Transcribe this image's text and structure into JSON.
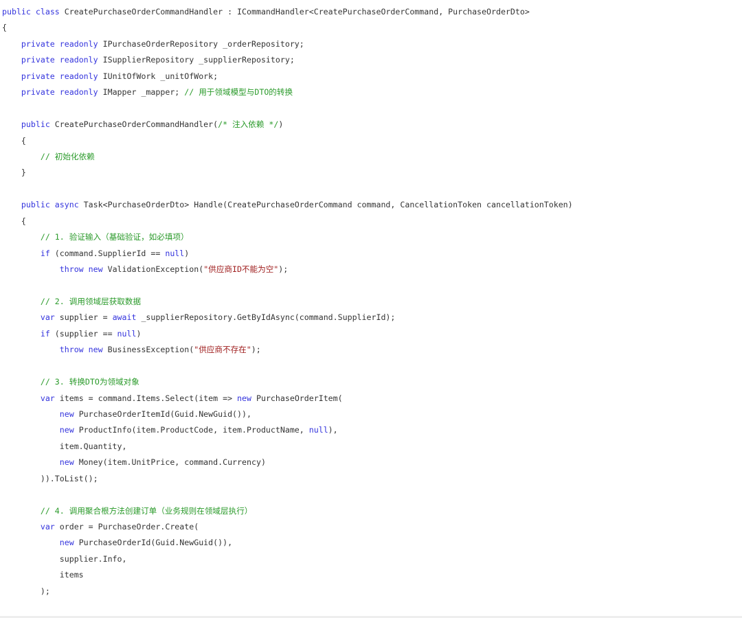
{
  "code": {
    "language": "csharp",
    "lines": [
      {
        "indent": 0,
        "tokens": [
          {
            "t": "kw",
            "v": "public"
          },
          {
            "t": "tx",
            "v": " "
          },
          {
            "t": "kw",
            "v": "class"
          },
          {
            "t": "tx",
            "v": " CreatePurchaseOrderCommandHandler : ICommandHandler<CreatePurchaseOrderCommand, PurchaseOrderDto>"
          }
        ]
      },
      {
        "indent": 0,
        "tokens": [
          {
            "t": "tx",
            "v": "{"
          }
        ]
      },
      {
        "indent": 1,
        "tokens": [
          {
            "t": "kw",
            "v": "private"
          },
          {
            "t": "tx",
            "v": " "
          },
          {
            "t": "kw",
            "v": "readonly"
          },
          {
            "t": "tx",
            "v": " IPurchaseOrderRepository _orderRepository;"
          }
        ]
      },
      {
        "indent": 1,
        "tokens": [
          {
            "t": "kw",
            "v": "private"
          },
          {
            "t": "tx",
            "v": " "
          },
          {
            "t": "kw",
            "v": "readonly"
          },
          {
            "t": "tx",
            "v": " ISupplierRepository _supplierRepository;"
          }
        ]
      },
      {
        "indent": 1,
        "tokens": [
          {
            "t": "kw",
            "v": "private"
          },
          {
            "t": "tx",
            "v": " "
          },
          {
            "t": "kw",
            "v": "readonly"
          },
          {
            "t": "tx",
            "v": " IUnitOfWork _unitOfWork;"
          }
        ]
      },
      {
        "indent": 1,
        "tokens": [
          {
            "t": "kw",
            "v": "private"
          },
          {
            "t": "tx",
            "v": " "
          },
          {
            "t": "kw",
            "v": "readonly"
          },
          {
            "t": "tx",
            "v": " IMapper _mapper; "
          },
          {
            "t": "cm",
            "v": "// 用于领域模型与DTO的转换"
          }
        ]
      },
      {
        "indent": 0,
        "tokens": []
      },
      {
        "indent": 1,
        "tokens": [
          {
            "t": "kw",
            "v": "public"
          },
          {
            "t": "tx",
            "v": " CreatePurchaseOrderCommandHandler("
          },
          {
            "t": "cm",
            "v": "/* 注入依赖 */"
          },
          {
            "t": "tx",
            "v": ")"
          }
        ]
      },
      {
        "indent": 1,
        "tokens": [
          {
            "t": "tx",
            "v": "{"
          }
        ]
      },
      {
        "indent": 2,
        "tokens": [
          {
            "t": "cm",
            "v": "// 初始化依赖"
          }
        ]
      },
      {
        "indent": 1,
        "tokens": [
          {
            "t": "tx",
            "v": "}"
          }
        ]
      },
      {
        "indent": 0,
        "tokens": []
      },
      {
        "indent": 1,
        "tokens": [
          {
            "t": "kw",
            "v": "public"
          },
          {
            "t": "tx",
            "v": " "
          },
          {
            "t": "kw",
            "v": "async"
          },
          {
            "t": "tx",
            "v": " Task<PurchaseOrderDto> Handle(CreatePurchaseOrderCommand command, CancellationToken cancellationToken)"
          }
        ]
      },
      {
        "indent": 1,
        "tokens": [
          {
            "t": "tx",
            "v": "{"
          }
        ]
      },
      {
        "indent": 2,
        "tokens": [
          {
            "t": "cm",
            "v": "// 1. 验证输入（基础验证，如必填项）"
          }
        ]
      },
      {
        "indent": 2,
        "tokens": [
          {
            "t": "kw",
            "v": "if"
          },
          {
            "t": "tx",
            "v": " (command.SupplierId == "
          },
          {
            "t": "kw",
            "v": "null"
          },
          {
            "t": "tx",
            "v": ")"
          }
        ]
      },
      {
        "indent": 3,
        "tokens": [
          {
            "t": "kw",
            "v": "throw"
          },
          {
            "t": "tx",
            "v": " "
          },
          {
            "t": "kw",
            "v": "new"
          },
          {
            "t": "tx",
            "v": " ValidationException("
          },
          {
            "t": "str",
            "v": "\"供应商ID不能为空\""
          },
          {
            "t": "tx",
            "v": ");"
          }
        ]
      },
      {
        "indent": 0,
        "tokens": []
      },
      {
        "indent": 2,
        "tokens": [
          {
            "t": "cm",
            "v": "// 2. 调用领域层获取数据"
          }
        ]
      },
      {
        "indent": 2,
        "tokens": [
          {
            "t": "kw",
            "v": "var"
          },
          {
            "t": "tx",
            "v": " supplier = "
          },
          {
            "t": "kw",
            "v": "await"
          },
          {
            "t": "tx",
            "v": " _supplierRepository.GetByIdAsync(command.SupplierId);"
          }
        ]
      },
      {
        "indent": 2,
        "tokens": [
          {
            "t": "kw",
            "v": "if"
          },
          {
            "t": "tx",
            "v": " (supplier == "
          },
          {
            "t": "kw",
            "v": "null"
          },
          {
            "t": "tx",
            "v": ")"
          }
        ]
      },
      {
        "indent": 3,
        "tokens": [
          {
            "t": "kw",
            "v": "throw"
          },
          {
            "t": "tx",
            "v": " "
          },
          {
            "t": "kw",
            "v": "new"
          },
          {
            "t": "tx",
            "v": " BusinessException("
          },
          {
            "t": "str",
            "v": "\"供应商不存在\""
          },
          {
            "t": "tx",
            "v": ");"
          }
        ]
      },
      {
        "indent": 0,
        "tokens": []
      },
      {
        "indent": 2,
        "tokens": [
          {
            "t": "cm",
            "v": "// 3. 转换DTO为领域对象"
          }
        ]
      },
      {
        "indent": 2,
        "tokens": [
          {
            "t": "kw",
            "v": "var"
          },
          {
            "t": "tx",
            "v": " items = command.Items.Select(item => "
          },
          {
            "t": "kw",
            "v": "new"
          },
          {
            "t": "tx",
            "v": " PurchaseOrderItem("
          }
        ]
      },
      {
        "indent": 3,
        "tokens": [
          {
            "t": "kw",
            "v": "new"
          },
          {
            "t": "tx",
            "v": " PurchaseOrderItemId(Guid.NewGuid()),"
          }
        ]
      },
      {
        "indent": 3,
        "tokens": [
          {
            "t": "kw",
            "v": "new"
          },
          {
            "t": "tx",
            "v": " ProductInfo(item.ProductCode, item.ProductName, "
          },
          {
            "t": "kw",
            "v": "null"
          },
          {
            "t": "tx",
            "v": "),"
          }
        ]
      },
      {
        "indent": 3,
        "tokens": [
          {
            "t": "tx",
            "v": "item.Quantity,"
          }
        ]
      },
      {
        "indent": 3,
        "tokens": [
          {
            "t": "kw",
            "v": "new"
          },
          {
            "t": "tx",
            "v": " Money(item.UnitPrice, command.Currency)"
          }
        ]
      },
      {
        "indent": 2,
        "tokens": [
          {
            "t": "tx",
            "v": ")).ToList();"
          }
        ]
      },
      {
        "indent": 0,
        "tokens": []
      },
      {
        "indent": 2,
        "tokens": [
          {
            "t": "cm",
            "v": "// 4. 调用聚合根方法创建订单（业务规则在领域层执行）"
          }
        ]
      },
      {
        "indent": 2,
        "tokens": [
          {
            "t": "kw",
            "v": "var"
          },
          {
            "t": "tx",
            "v": " order = PurchaseOrder.Create("
          }
        ]
      },
      {
        "indent": 3,
        "tokens": [
          {
            "t": "kw",
            "v": "new"
          },
          {
            "t": "tx",
            "v": " PurchaseOrderId(Guid.NewGuid()),"
          }
        ]
      },
      {
        "indent": 3,
        "tokens": [
          {
            "t": "tx",
            "v": "supplier.Info,"
          }
        ]
      },
      {
        "indent": 3,
        "tokens": [
          {
            "t": "tx",
            "v": "items"
          }
        ]
      },
      {
        "indent": 2,
        "tokens": [
          {
            "t": "tx",
            "v": ");"
          }
        ]
      }
    ]
  },
  "colors": {
    "keyword": "#3333dd",
    "comment": "#2a9a2a",
    "string": "#a02020",
    "text": "#333333",
    "background": "#ffffff"
  }
}
